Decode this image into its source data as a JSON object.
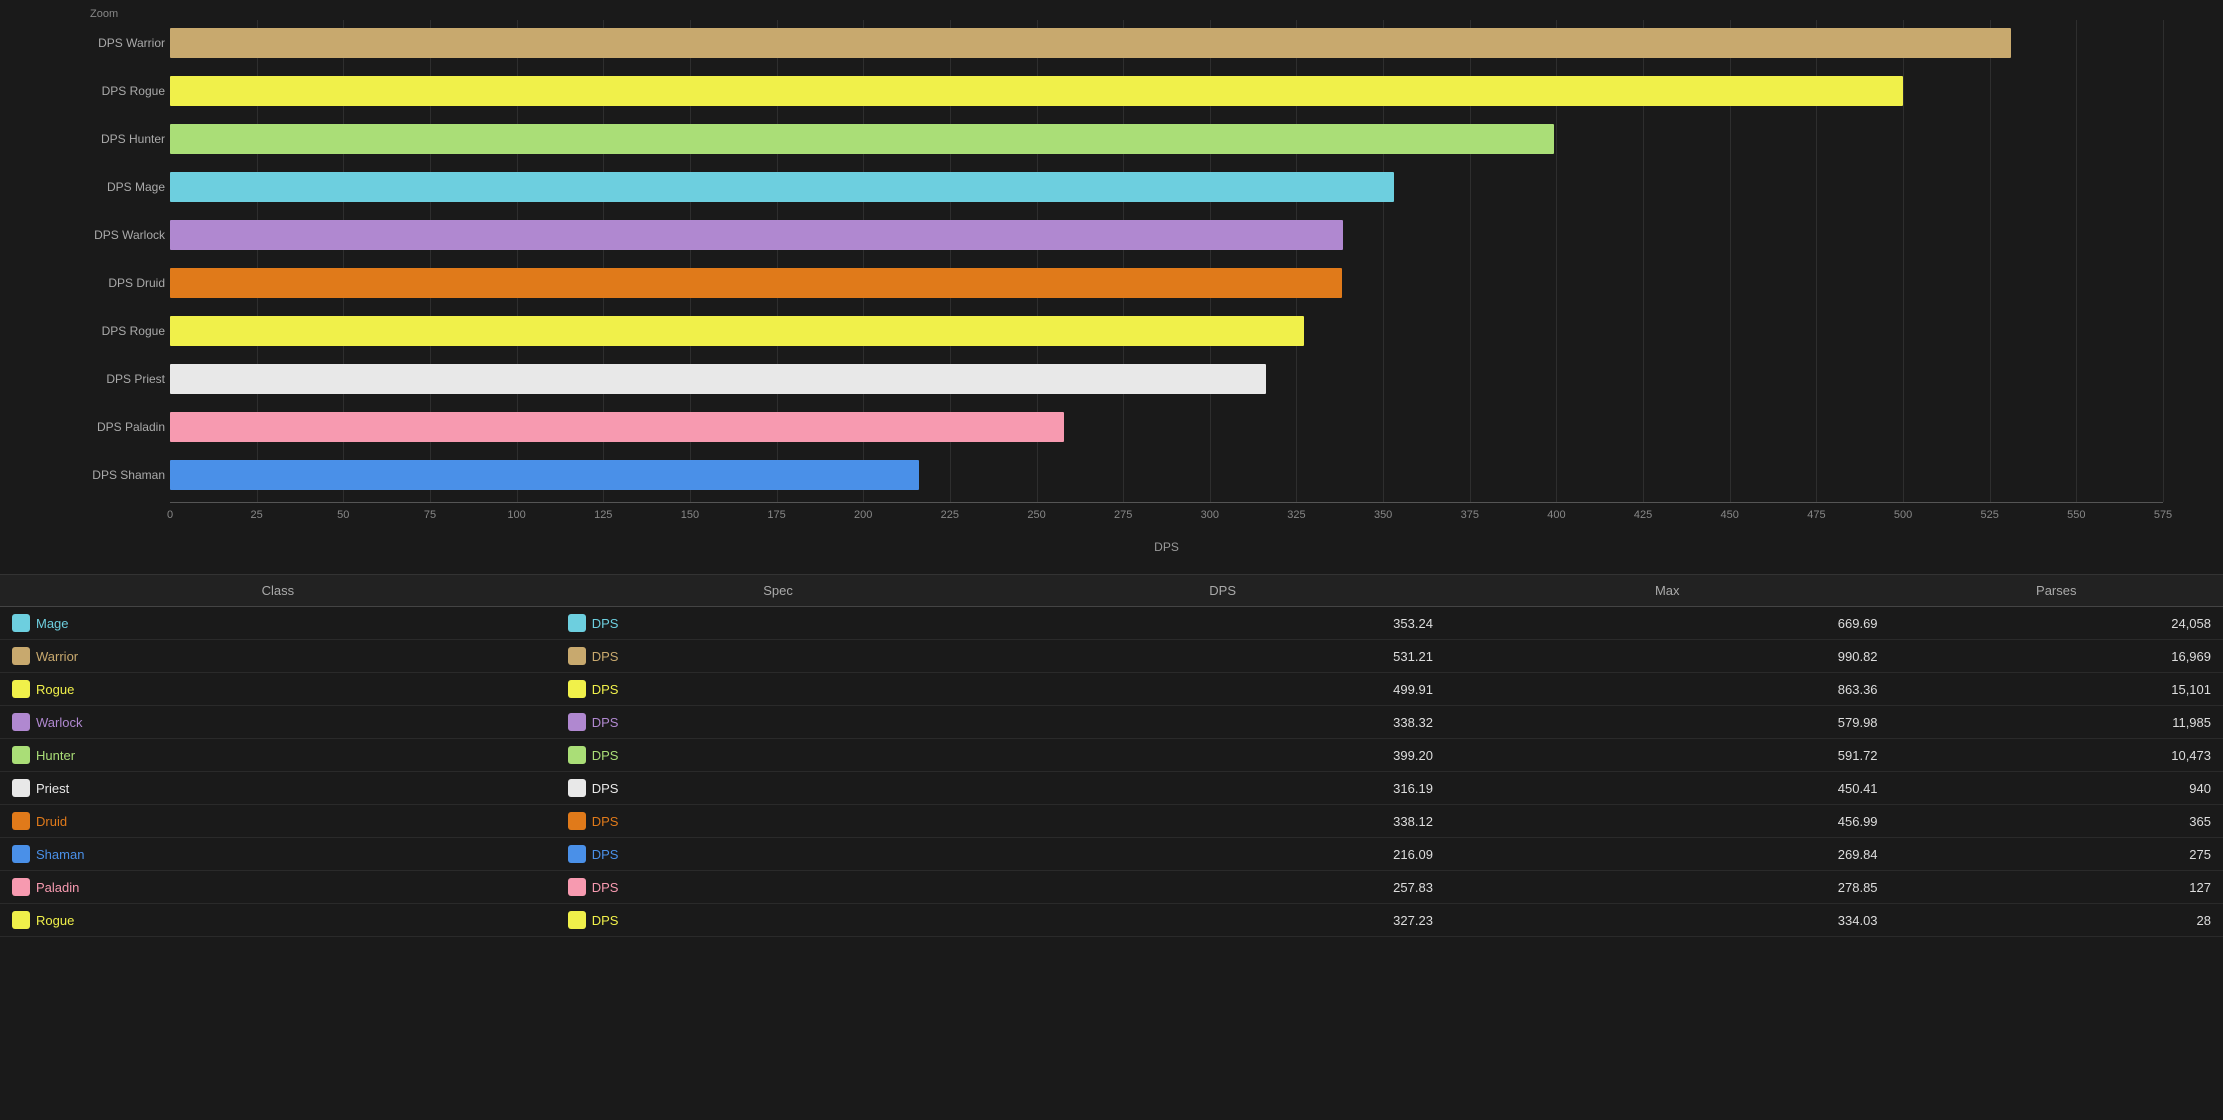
{
  "chart": {
    "zoom_label": "Zoom",
    "x_axis_label": "DPS",
    "x_ticks": [
      0,
      25,
      50,
      75,
      100,
      125,
      150,
      175,
      200,
      225,
      250,
      275,
      300,
      325,
      350,
      375,
      400,
      425,
      450,
      475,
      500,
      525,
      550,
      575
    ],
    "max_value": 575,
    "bars": [
      {
        "label": "DPS Warrior",
        "value": 531.21,
        "color": "#c8a96e"
      },
      {
        "label": "DPS Rogue",
        "value": 499.91,
        "color": "#f0f04a"
      },
      {
        "label": "DPS Hunter",
        "value": 399.2,
        "color": "#aade77"
      },
      {
        "label": "DPS Mage",
        "value": 353.24,
        "color": "#6dcfdf"
      },
      {
        "label": "DPS Warlock",
        "value": 338.32,
        "color": "#b088d0"
      },
      {
        "label": "DPS Druid",
        "value": 338.12,
        "color": "#e07a1a"
      },
      {
        "label": "DPS Rogue",
        "value": 327.23,
        "color": "#f0f04a"
      },
      {
        "label": "DPS Priest",
        "value": 316.19,
        "color": "#e8e8e8"
      },
      {
        "label": "DPS Paladin",
        "value": 257.83,
        "color": "#f79ab0"
      },
      {
        "label": "DPS Shaman",
        "value": 216.09,
        "color": "#4a90e8"
      }
    ]
  },
  "table": {
    "headers": [
      "Class",
      "Spec",
      "DPS",
      "Max",
      "Parses"
    ],
    "rows": [
      {
        "class_name": "Mage",
        "class_color": "#6dcfdf",
        "spec": "DPS",
        "dps": "353.24",
        "max": "669.69",
        "parses": "24,058"
      },
      {
        "class_name": "Warrior",
        "class_color": "#c8a96e",
        "spec": "DPS",
        "dps": "531.21",
        "max": "990.82",
        "parses": "16,969"
      },
      {
        "class_name": "Rogue",
        "class_color": "#f0f04a",
        "spec": "DPS",
        "dps": "499.91",
        "max": "863.36",
        "parses": "15,101"
      },
      {
        "class_name": "Warlock",
        "class_color": "#b088d0",
        "spec": "DPS",
        "dps": "338.32",
        "max": "579.98",
        "parses": "11,985"
      },
      {
        "class_name": "Hunter",
        "class_color": "#aade77",
        "spec": "DPS",
        "dps": "399.20",
        "max": "591.72",
        "parses": "10,473"
      },
      {
        "class_name": "Priest",
        "class_color": "#e8e8e8",
        "spec": "DPS",
        "dps": "316.19",
        "max": "450.41",
        "parses": "940"
      },
      {
        "class_name": "Druid",
        "class_color": "#e07a1a",
        "spec": "DPS",
        "dps": "338.12",
        "max": "456.99",
        "parses": "365"
      },
      {
        "class_name": "Shaman",
        "class_color": "#4a90e8",
        "spec": "DPS",
        "dps": "216.09",
        "max": "269.84",
        "parses": "275"
      },
      {
        "class_name": "Paladin",
        "class_color": "#f79ab0",
        "spec": "DPS",
        "dps": "257.83",
        "max": "278.85",
        "parses": "127"
      },
      {
        "class_name": "Rogue",
        "class_color": "#f0f04a",
        "spec": "DPS",
        "dps": "327.23",
        "max": "334.03",
        "parses": "28"
      }
    ]
  }
}
